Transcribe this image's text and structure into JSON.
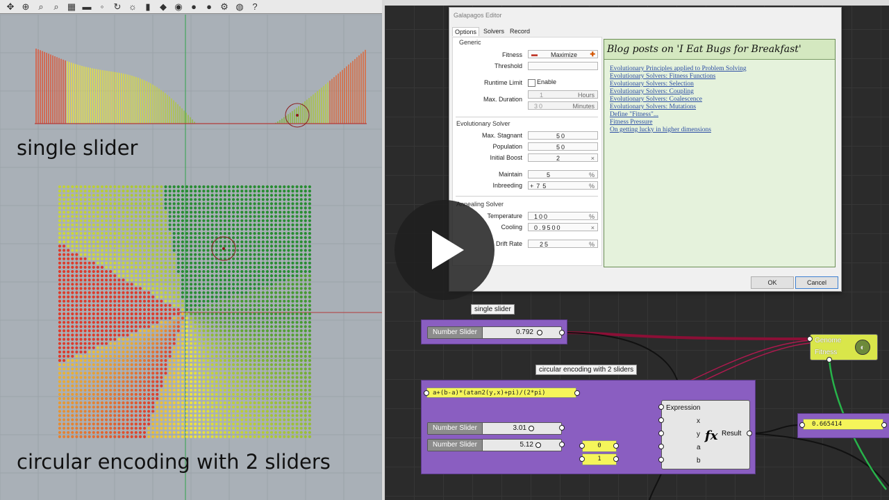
{
  "viewport": {
    "label_single": "single slider",
    "label_circular": "circular encoding with 2 sliders",
    "toolbar_icons": [
      "cursor-icon",
      "zoom-icon",
      "search-icon",
      "zoom-extents-icon",
      "grid-icon",
      "layer-icon",
      "point-icon",
      "rotate-icon",
      "bulb-icon",
      "lock-icon",
      "material-icon",
      "color-wheel-icon",
      "sphere-icon",
      "render-icon",
      "gear-icon",
      "globe-icon",
      "help-icon"
    ]
  },
  "galapagos": {
    "title": "Galapagos Editor",
    "tabs": [
      "Options",
      "Solvers",
      "Record"
    ],
    "generic": {
      "group": "Generic",
      "fitness_label": "Fitness",
      "fitness_value": "Maximize",
      "threshold_label": "Threshold",
      "threshold_value": "",
      "runtime_label": "Runtime Limit",
      "enable_label": "Enable",
      "duration_label": "Max. Duration",
      "hours_value": "1",
      "hours_unit": "Hours",
      "minutes_value": "30",
      "minutes_unit": "Minutes"
    },
    "evolutionary": {
      "group": "Evolutionary Solver",
      "max_stagnant_label": "Max. Stagnant",
      "max_stagnant": "50",
      "population_label": "Population",
      "population": "50",
      "initial_boost_label": "Initial Boost",
      "initial_boost": "2",
      "initial_boost_unit": "×",
      "maintain_label": "Maintain",
      "maintain": "5",
      "maintain_unit": "%",
      "inbreeding_label": "Inbreeding",
      "inbreeding": "+75",
      "inbreeding_unit": "%"
    },
    "annealing": {
      "group": "Annealing Solver",
      "temperature_label": "Temperature",
      "temperature": "100",
      "temperature_unit": "%",
      "cooling_label": "Cooling",
      "cooling": "0.9500",
      "cooling_unit": "×",
      "drift_label": "Drift Rate",
      "drift": "25",
      "drift_unit": "%"
    },
    "blog": {
      "title": "Blog posts on 'I Eat Bugs for Breakfast'",
      "links": [
        "Evolutionary Principles applied to Problem Solving",
        "Evolutionary Solvers: Fitness Functions",
        "Evolutionary Solvers: Selection",
        "Evolutionary Solvers: Coupling",
        "Evolutionary Solvers: Coalescence",
        "Evolutionary Solvers: Mutations",
        "Define \"Fitness\"...",
        "Fitness Pressure",
        "On getting lucky in higher dimensions"
      ]
    },
    "ok_label": "OK",
    "cancel_label": "Cancel"
  },
  "grasshopper": {
    "single_group_label": "single slider",
    "circular_group_label": "circular encoding with 2 sliders",
    "slider_name": "Number Slider",
    "slider_single_value": "0.792",
    "slider_a_value": "3.01",
    "slider_b_value": "5.12",
    "expression_text": "a+(b-a)*(atan2(y,x)+pi)/(2*pi)",
    "panel_a": "0",
    "panel_b": "1",
    "expression_title": "Expression",
    "inputs": [
      "x",
      "y",
      "a",
      "b"
    ],
    "fx_symbol": "fx",
    "result_label": "Result",
    "result_value": "0.665414",
    "galapagos_genome": "Genome",
    "galapagos_fitness": "Fitness"
  },
  "colors": {
    "group_purple": "#8a5ec1",
    "panel_yellow": "#f5f55a",
    "wire_crimson": "#8b0f36",
    "wire_green": "#27b34a",
    "blog_green": "#e5f2dc"
  }
}
